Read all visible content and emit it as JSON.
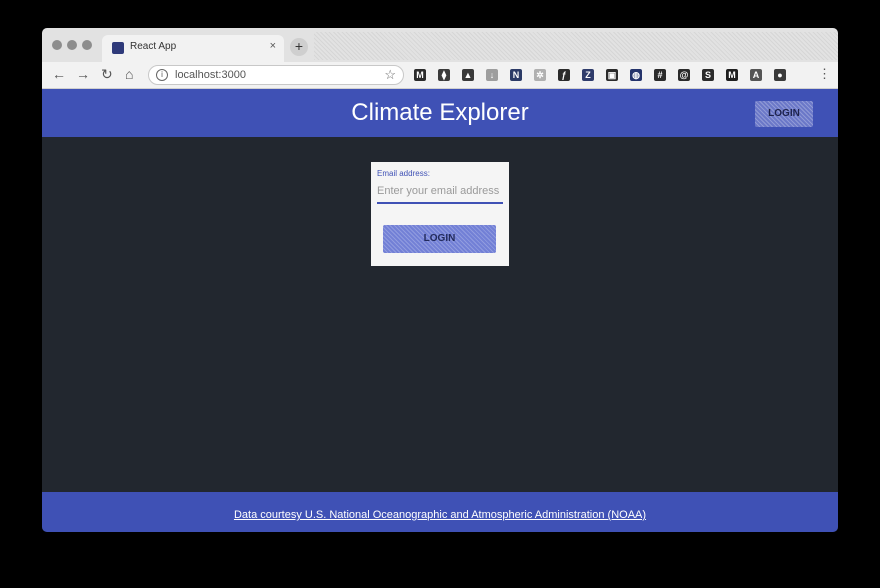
{
  "browser": {
    "tab_title": "React App",
    "tab_close": "×",
    "new_tab": "+",
    "url": "localhost:3000",
    "info_glyph": "i",
    "star_glyph": "☆",
    "menu_glyph": "⋮",
    "nav": {
      "back": "←",
      "forward": "→",
      "reload": "↻",
      "home": "⌂"
    },
    "extensions": [
      {
        "name": "gmail-ext-icon",
        "glyph": "M",
        "color": "#2b2b2b"
      },
      {
        "name": "pocket-ext-icon",
        "glyph": "⧫",
        "color": "#3b3b3b"
      },
      {
        "name": "drive-ext-icon",
        "glyph": "▲",
        "color": "#3a3a3a"
      },
      {
        "name": "download-ext-icon",
        "glyph": "↓",
        "color": "#9e9e9e"
      },
      {
        "name": "onenote-ext-icon",
        "glyph": "N",
        "color": "#2b3a66"
      },
      {
        "name": "gear-ext-icon",
        "glyph": "✲",
        "color": "#b0b0b0"
      },
      {
        "name": "formula-ext-icon",
        "glyph": "ƒ",
        "color": "#2b2b2b"
      },
      {
        "name": "zotero-ext-icon",
        "glyph": "Z",
        "color": "#2f3c6b"
      },
      {
        "name": "screenshot-ext-icon",
        "glyph": "▣",
        "color": "#2b2b2b"
      },
      {
        "name": "globe-ext-icon",
        "glyph": "◍",
        "color": "#24336b"
      },
      {
        "name": "hash-ext-icon",
        "glyph": "#",
        "color": "#2b2b2b"
      },
      {
        "name": "at-ext-icon",
        "glyph": "@",
        "color": "#2b2b2b"
      },
      {
        "name": "s-ext-icon",
        "glyph": "S",
        "color": "#2b2b2b"
      },
      {
        "name": "m-ext-icon",
        "glyph": "M",
        "color": "#1f1f1f"
      },
      {
        "name": "a-ext-icon",
        "glyph": "A",
        "color": "#555555"
      },
      {
        "name": "profile-avatar-icon",
        "glyph": "●",
        "color": "#3a3a3a"
      }
    ]
  },
  "app": {
    "title": "Climate Explorer",
    "header_login": "LOGIN",
    "login_card": {
      "email_label": "Email address:",
      "email_placeholder": "Enter your email address",
      "email_value": "",
      "login_button": "LOGIN"
    },
    "footer_link": "Data courtesy U.S. National Oceanographic and Atmospheric Administration (NOAA)"
  },
  "colors": {
    "primary": "#3f51b5",
    "background": "#22272f",
    "card": "#f5f5f5",
    "button": "#7280d6"
  }
}
